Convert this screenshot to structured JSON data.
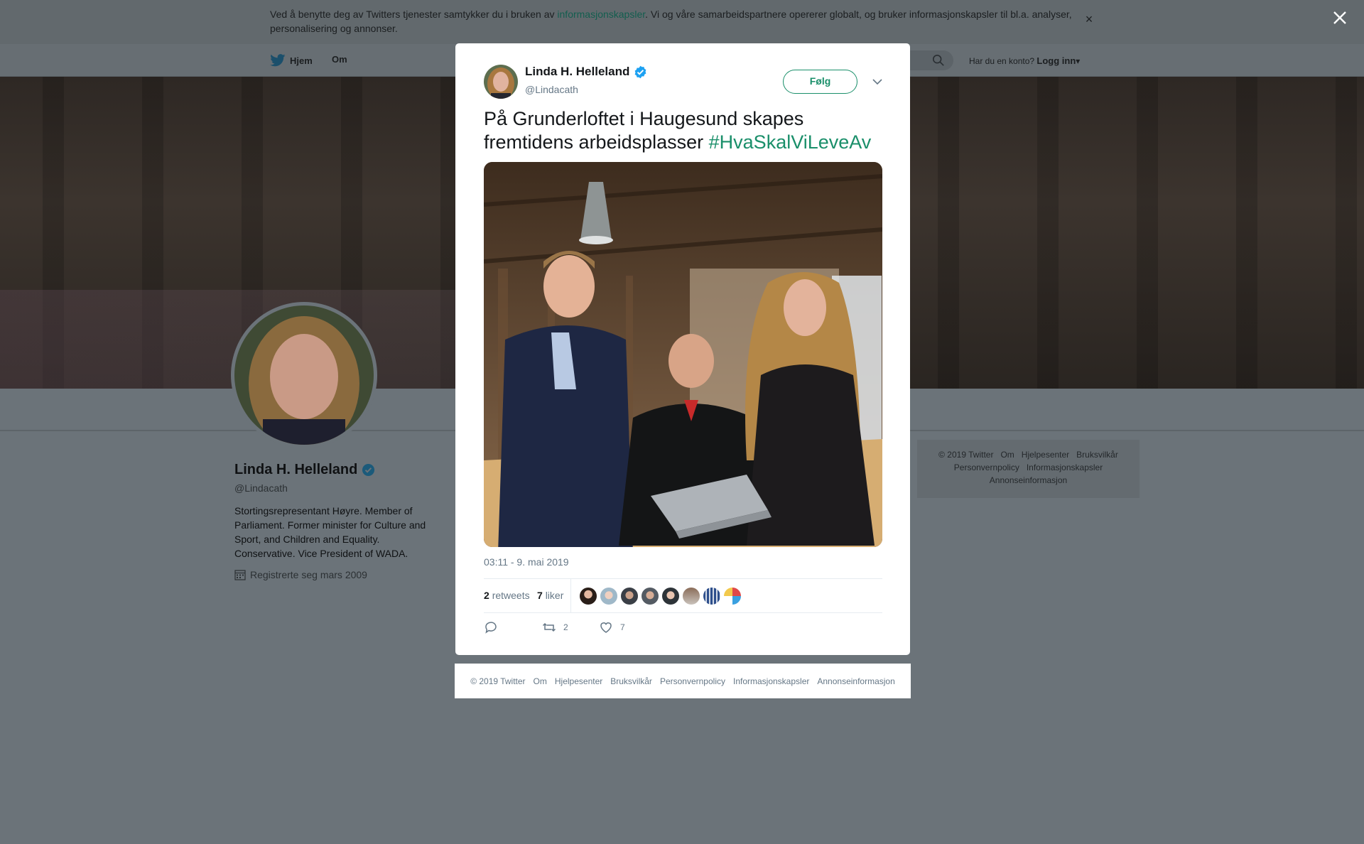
{
  "cookie_notice": {
    "text_before": "Ved å benytte deg av Twitters tjenester samtykker du i bruken av ",
    "link": "informasjonskapsler",
    "text_after": ". Vi og våre samarbeidspartnere opererer globalt, og bruker informasjonskapsler til bl.a. analyser, personalisering og annonser.",
    "close": "×"
  },
  "nav": {
    "home": "Hjem",
    "about": "Om",
    "account_prompt": "Har du en konto?",
    "login": "Logg inn"
  },
  "profile": {
    "name": "Linda H. Helleland",
    "handle": "@Lindacath",
    "bio": "Stortingsrepresentant Høyre. Member of Parliament. Former minister for Culture and Sport, and Children and Equality. Conservative. Vice President of WADA.",
    "joined": "Registrerte seg mars 2009"
  },
  "side_footer": {
    "links": [
      "© 2019 Twitter",
      "Om",
      "Hjelpesenter",
      "Bruksvilkår",
      "Personvernpolicy",
      "Informasjonskapsler",
      "Annonseinformasjon"
    ]
  },
  "tweet": {
    "author_name": "Linda H. Helleland",
    "author_handle": "@Lindacath",
    "follow_label": "Følg",
    "text": "På Grunderloftet i Haugesund skapes fremtidens arbeidsplasser ",
    "hashtag": "#HvaSkalViLeveAv",
    "timestamp": "03:11 - 9. mai 2019",
    "retweets_count": "2",
    "retweets_label": "retweets",
    "likes_count": "7",
    "likes_label": "liker",
    "action_retweet_count": "2",
    "action_like_count": "7"
  },
  "modal_footer": {
    "links": [
      "© 2019 Twitter",
      "Om",
      "Hjelpesenter",
      "Bruksvilkår",
      "Personvernpolicy",
      "Informasjonskapsler",
      "Annonseinformasjon"
    ]
  },
  "colors": {
    "accent": "#1a8f6a",
    "verified": "#1da1f2",
    "overlay": "#6b7379"
  },
  "icons": [
    "twitter-bird-icon",
    "search-icon",
    "verified-badge-icon",
    "chevron-down-icon",
    "reply-icon",
    "retweet-icon",
    "heart-icon",
    "calendar-icon",
    "close-icon"
  ]
}
